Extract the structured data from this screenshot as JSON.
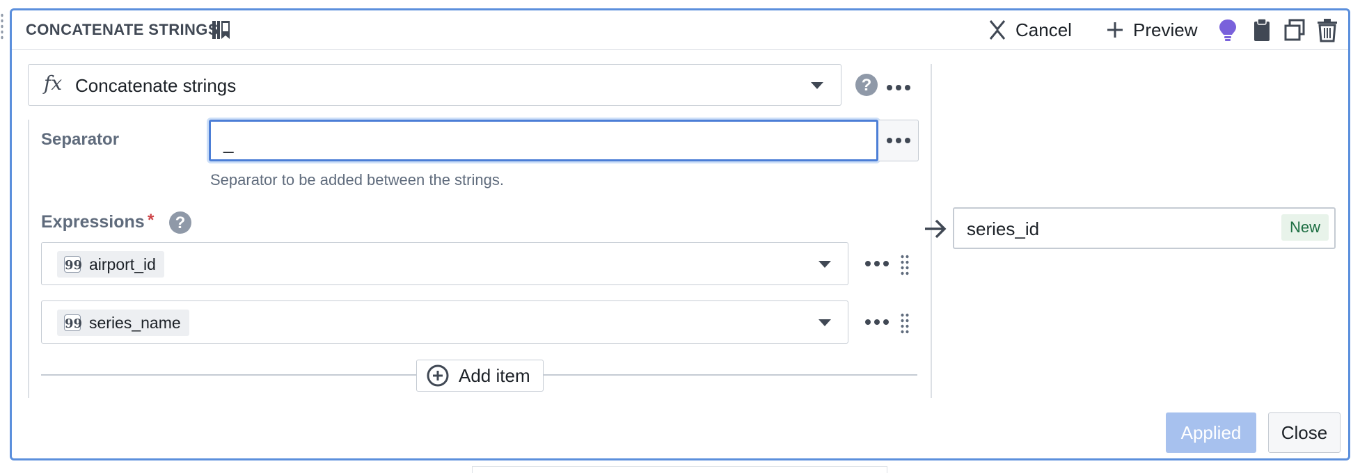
{
  "header": {
    "title": "CONCATENATE STRINGS",
    "cancel_label": "Cancel",
    "preview_label": "Preview",
    "icons": [
      "book-icon",
      "cancel-icon",
      "plus-icon",
      "lightbulb-icon",
      "clipboard-icon",
      "duplicate-icon",
      "trash-icon"
    ]
  },
  "function_select": {
    "icon": "fx-icon",
    "icon_text": "fx",
    "label": "Concatenate strings"
  },
  "separator": {
    "label": "Separator",
    "value": "_",
    "helper_text": "Separator to be added between the strings."
  },
  "expressions": {
    "label": "Expressions",
    "required_mark": "*",
    "items": [
      {
        "value": "airport_id"
      },
      {
        "value": "series_name"
      }
    ],
    "add_item_label": "Add item"
  },
  "output": {
    "column_name": "series_id",
    "badge": "New"
  },
  "footer": {
    "applied_label": "Applied",
    "close_label": "Close"
  },
  "colors": {
    "accent": "#4c7ed6",
    "applied_disabled": "#a7c1ee",
    "lightbulb": "#7961db",
    "new_badge_text": "#1c6e42",
    "required": "#cd4246"
  }
}
